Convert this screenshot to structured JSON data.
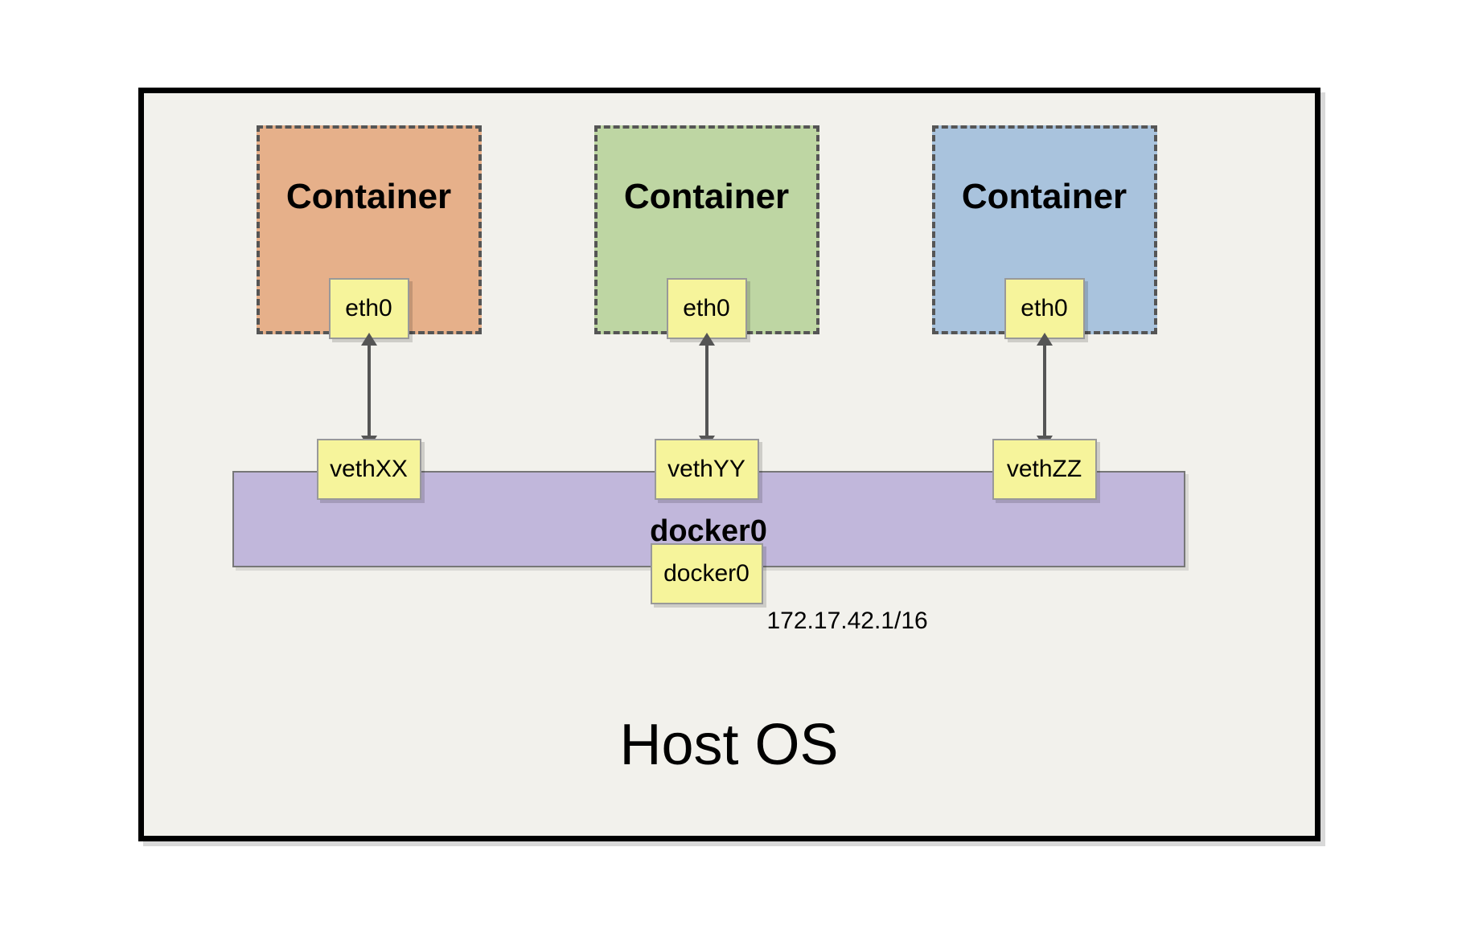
{
  "host": {
    "label": "Host OS"
  },
  "bridge": {
    "name": "docker0",
    "interface_label": "docker0",
    "ip": "172.17.42.1/16"
  },
  "containers": [
    {
      "title": "Container",
      "eth": "eth0",
      "veth": "vethXX",
      "color": "orange"
    },
    {
      "title": "Container",
      "eth": "eth0",
      "veth": "vethYY",
      "color": "green"
    },
    {
      "title": "Container",
      "eth": "eth0",
      "veth": "vethZZ",
      "color": "blue"
    }
  ],
  "icons": {
    "bidirectional_arrow": "double-arrow-icon"
  }
}
